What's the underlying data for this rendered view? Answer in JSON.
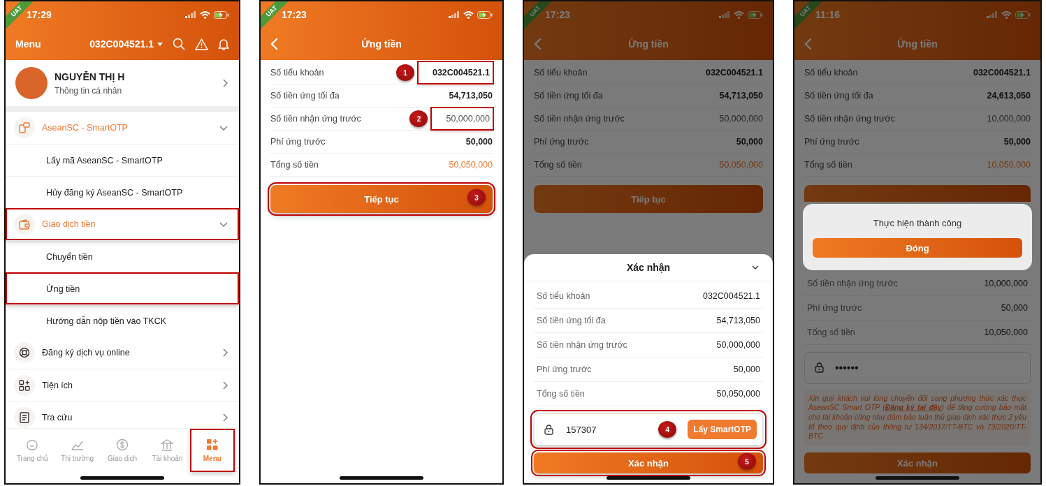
{
  "screens": [
    {
      "kind": "menu",
      "time": "17:29",
      "badge": "UAT",
      "header": {
        "title": "Menu",
        "account": "032C004521.1"
      },
      "profile": {
        "name": "NGUYỄN THỊ H",
        "subtitle": "Thông tin cá nhân"
      },
      "menu_items": [
        {
          "label": "AseanSC - SmartOTP",
          "expanded": true,
          "highlighted": false,
          "children": [
            {
              "label": "Lấy mã AseanSC - SmartOTP",
              "highlighted": false
            },
            {
              "label": "Hủy đăng ký AseanSC - SmartOTP",
              "highlighted": false
            }
          ]
        },
        {
          "label": "Giao dịch tiền",
          "expanded": true,
          "highlighted": true,
          "children": [
            {
              "label": "Chuyển tiền",
              "highlighted": false
            },
            {
              "label": "Ứng tiền",
              "highlighted": true
            },
            {
              "label": "Hướng dẫn nộp tiền vào TKCK",
              "highlighted": false
            }
          ]
        },
        {
          "label": "Đăng ký dịch vụ online",
          "expanded": false,
          "highlighted": false
        },
        {
          "label": "Tiện ích",
          "expanded": false,
          "highlighted": false
        },
        {
          "label": "Tra cứu",
          "expanded": false,
          "highlighted": false
        }
      ],
      "tab_bar": [
        {
          "label": "Trang chủ",
          "selected": false,
          "highlighted": false
        },
        {
          "label": "Thị trường",
          "selected": false,
          "highlighted": false
        },
        {
          "label": "Giao dịch",
          "selected": false,
          "highlighted": false
        },
        {
          "label": "Tài khoản",
          "selected": false,
          "highlighted": false
        },
        {
          "label": "Menu",
          "selected": true,
          "highlighted": true
        }
      ]
    },
    {
      "kind": "form",
      "time": "17:23",
      "badge": "UAT",
      "title": "Ứng tiền",
      "rows": [
        {
          "label": "Số tiểu khoản",
          "value": "032C004521.1",
          "kind": "plain",
          "marker": "1",
          "highlighted": true
        },
        {
          "label": "Số tiền ứng tối đa",
          "value": "54,713,050",
          "kind": "plain",
          "highlighted": false
        },
        {
          "label": "Số tiền nhận ứng trước",
          "value": "50,000,000",
          "kind": "input",
          "marker": "2",
          "highlighted": true
        },
        {
          "label": "Phí ứng trước",
          "value": "50,000",
          "kind": "plain",
          "highlighted": false
        },
        {
          "label": "Tổng số tiền",
          "value": "50,050,000",
          "kind": "total",
          "highlighted": false
        }
      ],
      "button": {
        "label": "Tiếp tục",
        "marker": "3",
        "highlighted": true
      }
    },
    {
      "kind": "confirm",
      "time": "17:23",
      "badge": "UAT",
      "title": "Ứng tiền",
      "rows": [
        {
          "label": "Số tiểu khoản",
          "value": "032C004521.1",
          "kind": "plain",
          "highlighted": false
        },
        {
          "label": "Số tiền ứng tối đa",
          "value": "54,713,050",
          "kind": "plain",
          "highlighted": false
        },
        {
          "label": "Số tiền nhận ứng trước",
          "value": "50,000,000",
          "kind": "input",
          "highlighted": false
        },
        {
          "label": "Phí ứng trước",
          "value": "50,000",
          "kind": "plain",
          "highlighted": false
        },
        {
          "label": "Tổng số tiền",
          "value": "50,050,000",
          "kind": "total",
          "highlighted": false
        }
      ],
      "button": {
        "label": "Tiếp tục",
        "highlighted": false
      },
      "sheet": {
        "title": "Xác nhận",
        "rows": [
          {
            "label": "Số tiểu khoản",
            "value": "032C004521.1"
          },
          {
            "label": "Số tiền ứng tối đa",
            "value": "54,713,050"
          },
          {
            "label": "Số tiền nhận ứng trước",
            "value": "50,000,000"
          },
          {
            "label": "Phí ứng trước",
            "value": "50,000"
          },
          {
            "label": "Tổng số tiền",
            "value": "50,050,000"
          }
        ],
        "otp": {
          "value": "157307",
          "button": "Lấy SmartOTP",
          "marker": "4",
          "highlighted": true
        },
        "submit": {
          "label": "Xác nhận",
          "marker": "5",
          "highlighted": true
        }
      }
    },
    {
      "kind": "success",
      "time": "11:16",
      "badge": "UAT",
      "title": "Ứng tiền",
      "rows": [
        {
          "label": "Số tiểu khoản",
          "value": "032C004521.1",
          "kind": "plain",
          "highlighted": false
        },
        {
          "label": "Số tiền ứng tối đa",
          "value": "24,613,050",
          "kind": "plain",
          "highlighted": false
        },
        {
          "label": "Số tiền nhận ứng trước",
          "value": "10,000,000",
          "kind": "input",
          "highlighted": false
        },
        {
          "label": "Phí ứng trước",
          "value": "50,000",
          "kind": "plain",
          "highlighted": false
        },
        {
          "label": "Tổng số tiền",
          "value": "10,050,000",
          "kind": "total",
          "highlighted": false
        }
      ],
      "button": {
        "highlighted": false
      },
      "sheet": {
        "rows": [
          {
            "label": "Số tiền nhận ứng trước",
            "value": "10,000,000"
          },
          {
            "label": "Phí ứng trước",
            "value": "50,000"
          },
          {
            "label": "Tổng số tiền",
            "value": "10,050,000"
          }
        ],
        "password": {
          "value": "••••••"
        },
        "notice": {
          "before": "Xin quý khách vui lòng chuyển đổi sang phương thức xác thực AseanSC Smart OTP (",
          "link": "Đăng ký tại đây",
          "after": ") để tăng cường bảo mật cho tài khoản cũng như đảm bảo tuân thủ giao dịch xác thực 2 yếu tố theo quy định của thông tư 134/2017/TT-BTC và 73/2020/TT-BTC"
        },
        "submit": {
          "label": "Xác nhận"
        }
      },
      "dialog": {
        "message": "Thực hiện thành công",
        "button": "Đóng"
      }
    }
  ]
}
